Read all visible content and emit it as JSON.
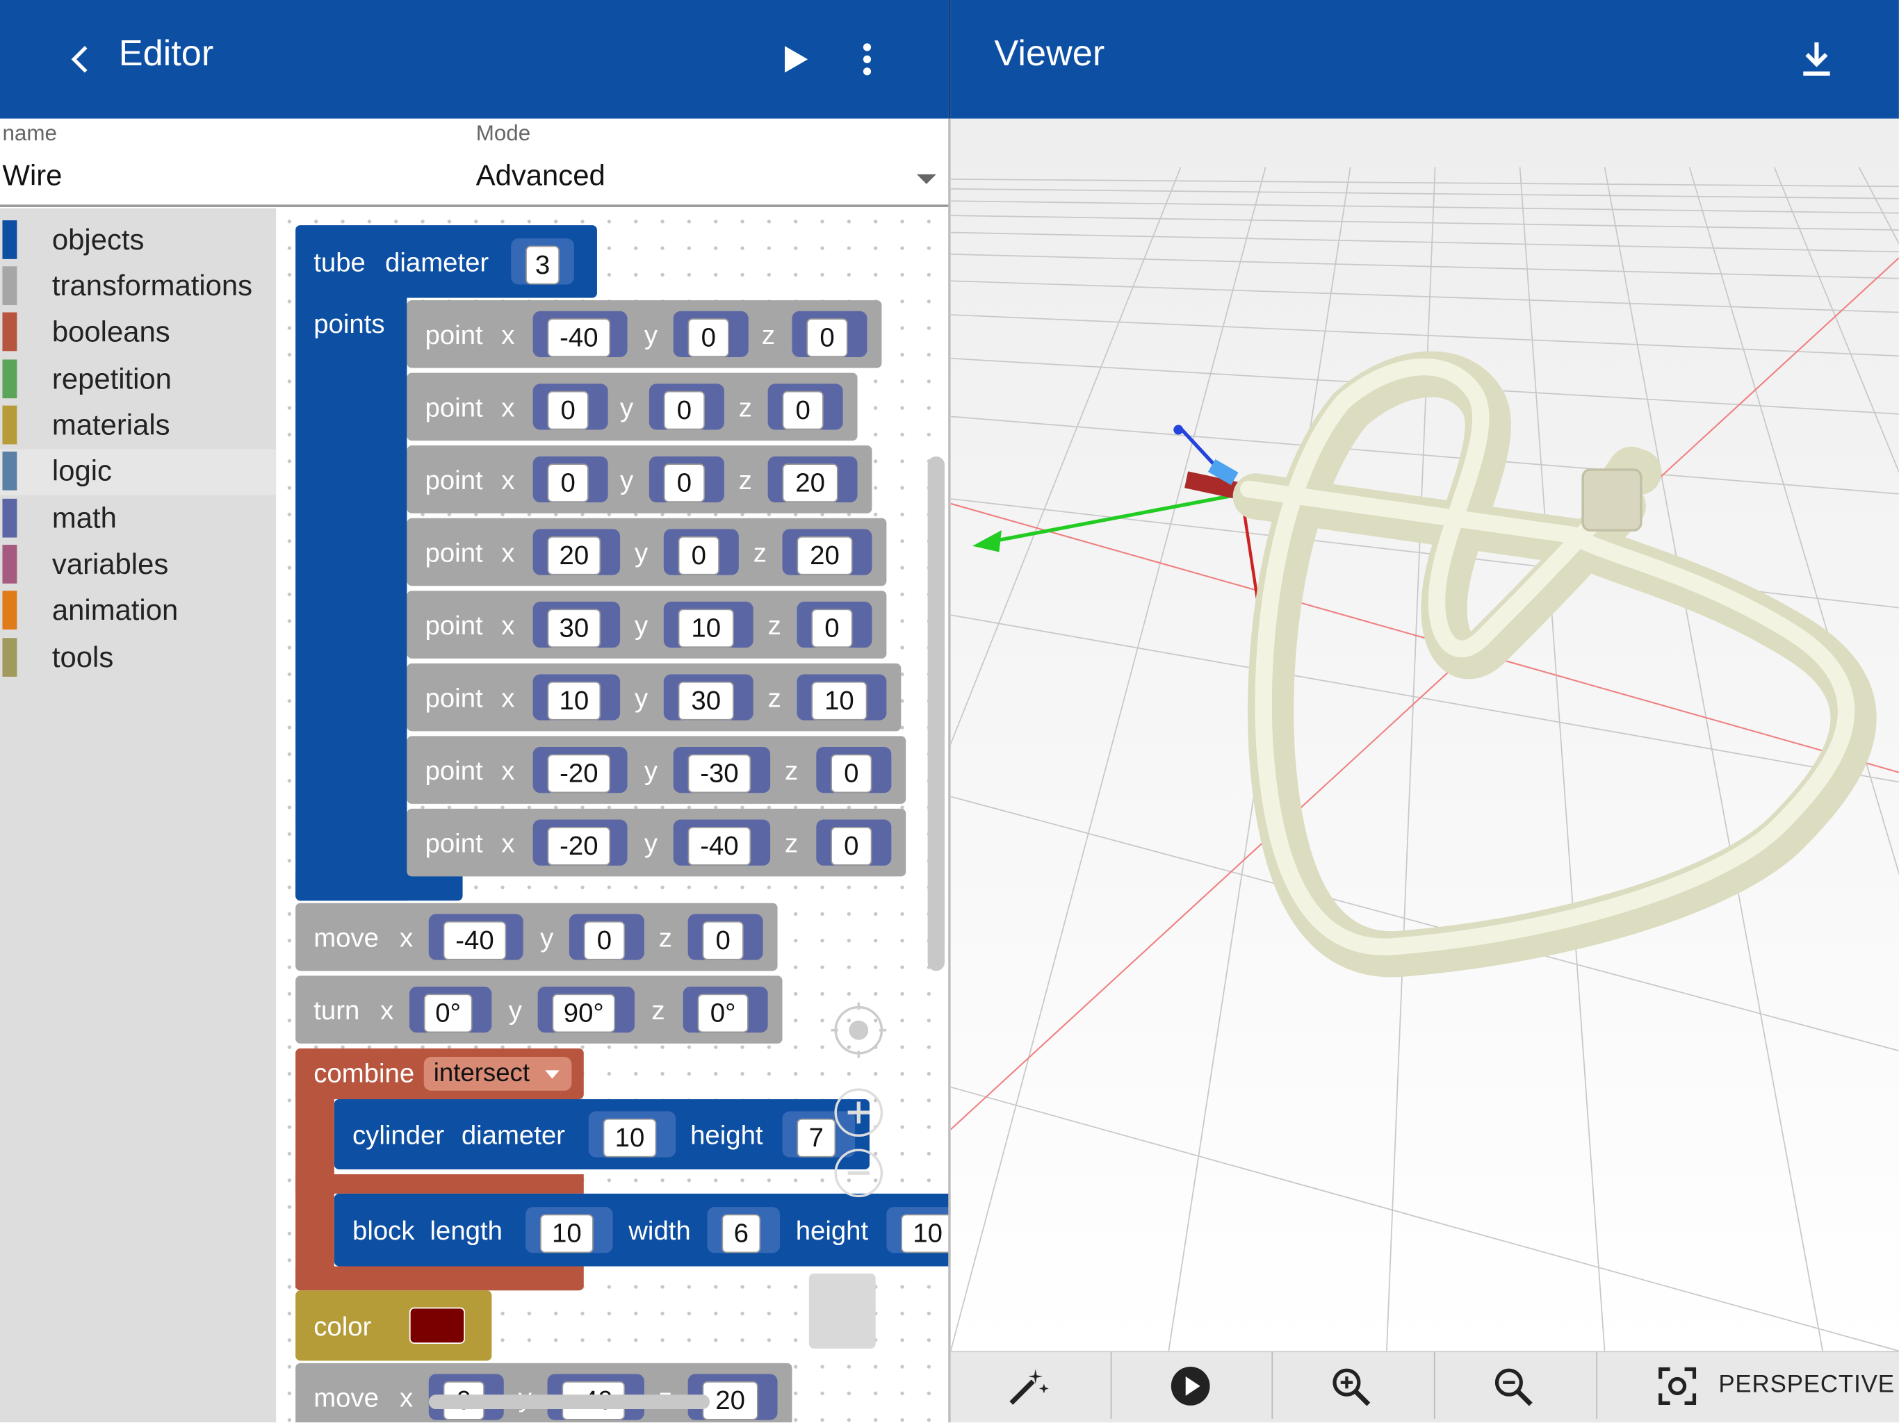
{
  "editor": {
    "title": "Editor",
    "name_label": "name",
    "name_value": "Wire",
    "mode_label": "Mode",
    "mode_value": "Advanced"
  },
  "viewer": {
    "title": "Viewer"
  },
  "categories": [
    {
      "label": "objects",
      "color": "#0d4fa3"
    },
    {
      "label": "transformations",
      "color": "#a6a6a6"
    },
    {
      "label": "booleans",
      "color": "#b8553f"
    },
    {
      "label": "repetition",
      "color": "#5ba55b"
    },
    {
      "label": "materials",
      "color": "#b59c38"
    },
    {
      "label": "logic",
      "color": "#5b80a5"
    },
    {
      "label": "math",
      "color": "#5b67a5"
    },
    {
      "label": "variables",
      "color": "#a55b80"
    },
    {
      "label": "animation",
      "color": "#e07b1a"
    },
    {
      "label": "tools",
      "color": "#a09a5c"
    }
  ],
  "blocks": {
    "tube": {
      "label": "tube",
      "param": "diameter",
      "value": "3",
      "points_label": "points"
    },
    "points": [
      {
        "x": "-40",
        "y": "0",
        "z": "0"
      },
      {
        "x": "0",
        "y": "0",
        "z": "0"
      },
      {
        "x": "0",
        "y": "0",
        "z": "20"
      },
      {
        "x": "20",
        "y": "0",
        "z": "20"
      },
      {
        "x": "30",
        "y": "10",
        "z": "0"
      },
      {
        "x": "10",
        "y": "30",
        "z": "10"
      },
      {
        "x": "-20",
        "y": "-30",
        "z": "0"
      },
      {
        "x": "-20",
        "y": "-40",
        "z": "0"
      }
    ],
    "point_label": "point",
    "x_label": "x",
    "y_label": "y",
    "z_label": "z",
    "move1": {
      "label": "move",
      "x": "-40",
      "y": "0",
      "z": "0"
    },
    "turn": {
      "label": "turn",
      "x": "0°",
      "y": "90°",
      "z": "0°"
    },
    "combine": {
      "label": "combine",
      "op": "intersect"
    },
    "cylinder": {
      "label": "cylinder",
      "p1": "diameter",
      "v1": "10",
      "p2": "height",
      "v2": "7"
    },
    "block": {
      "label": "block",
      "p1": "length",
      "v1": "10",
      "p2": "width",
      "v2": "6",
      "p3": "height",
      "v3": "10"
    },
    "color": {
      "label": "color",
      "swatch": "#7a0000"
    },
    "move2": {
      "label": "move",
      "x": "0",
      "y": "-40",
      "z": "20"
    }
  },
  "toolbar": {
    "perspective_label": "PERSPECTIVE"
  },
  "icons": [
    "back-arrow-icon",
    "play-icon",
    "more-vert-icon",
    "download-icon",
    "dropdown-arrow-icon",
    "magic-wand-icon",
    "play-circle-icon",
    "zoom-in-icon",
    "zoom-out-icon",
    "camera-focus-icon"
  ]
}
